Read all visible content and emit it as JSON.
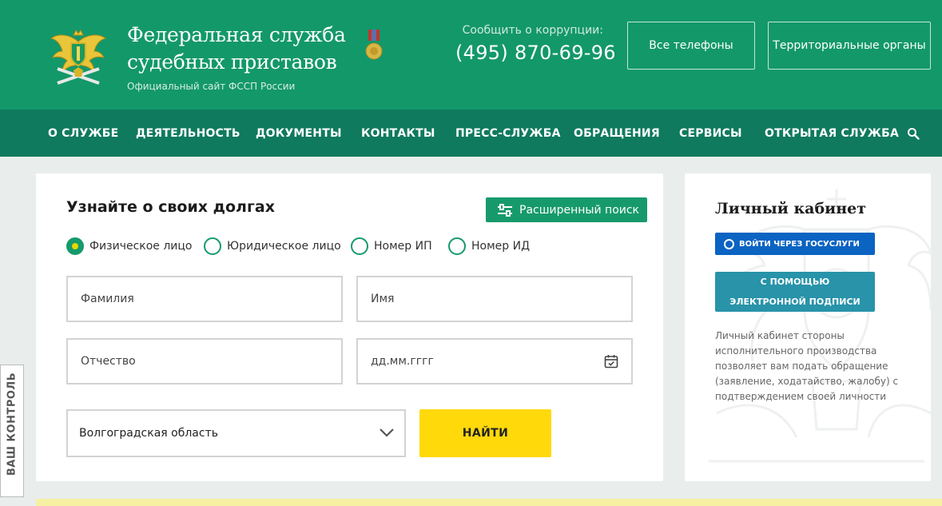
{
  "header": {
    "title": "Федеральная служба судебных приставов",
    "subtitle": "Официальный сайт ФССП России",
    "corruption_label": "Сообщить о коррупции:",
    "corruption_phone": "(495) 870-69-96",
    "phones_button": "Все телефоны",
    "territorial_button": "Территориальные органы"
  },
  "nav": {
    "items": [
      "О СЛУЖБЕ",
      "ДЕЯТЕЛЬНОСТЬ",
      "ДОКУМЕНТЫ",
      "КОНТАКТЫ",
      "ПРЕСС-СЛУЖБА",
      "ОБРАЩЕНИЯ",
      "СЕРВИСЫ",
      "ОТКРЫТАЯ СЛУЖБА"
    ],
    "search_icon": "search-icon"
  },
  "debt_search": {
    "title": "Узнайте о своих долгах",
    "advanced_button": "Расширенный поиск",
    "radios": [
      "Физическое лицо",
      "Юридическое лицо",
      "Номер ИП",
      "Номер ИД"
    ],
    "selected_radio": "Физическое лицо",
    "fields": {
      "last_name_placeholder": "Фамилия",
      "first_name_placeholder": "Имя",
      "patronymic_placeholder": "Отчество",
      "birthdate_placeholder": "дд.мм.гггг"
    },
    "region_selected": "Волгоградская область",
    "find_button": "НАЙТИ"
  },
  "cabinet": {
    "title": "Личный кабинет",
    "gosuslugi_button": "ВОЙТИ ЧЕРЕЗ ГОСУСЛУГИ",
    "signature_button_line1": "С ПОМОЩЬЮ",
    "signature_button_line2": "ЭЛЕКТРОННОЙ ПОДПИСИ",
    "description": "Личный кабинет стороны исполнительного производства позволяет вам подать обращение (заявление, ходатайство, жалобу) с подтверждением своей личности"
  },
  "side_tab": {
    "label": "ВАШ КОНТРОЛЬ"
  },
  "colors": {
    "header_green": "#13986a",
    "nav_green": "#0f7a5d",
    "accent_green": "#169a6c",
    "find_yellow": "#ffd90a",
    "gosuslugi_blue": "#0b63c2",
    "signature_teal": "#2893a9"
  }
}
